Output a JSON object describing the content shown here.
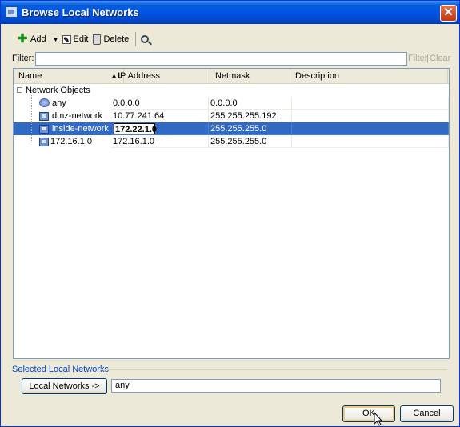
{
  "window": {
    "title": "Browse Local Networks",
    "close_symbol": "✕"
  },
  "toolbar": {
    "add_label": "Add",
    "edit_label": "Edit",
    "delete_label": "Delete",
    "dropdown_arrow": "▼"
  },
  "filter": {
    "label": "Filter:",
    "value": "",
    "filter_button": "Filter",
    "separator": "|",
    "clear_button": "Clear"
  },
  "table": {
    "columns": [
      "Name",
      "IP Address",
      "Netmask",
      "Description"
    ],
    "sort_indicator": "▲1",
    "group_label": "Network Objects",
    "tree_toggle": "−",
    "rows": [
      {
        "name": "any",
        "ip": "0.0.0.0",
        "netmask": "0.0.0.0",
        "description": "",
        "icon": "network-globe-icon"
      },
      {
        "name": "dmz-network",
        "ip": "10.77.241.64",
        "netmask": "255.255.255.192",
        "description": "",
        "icon": "network-object-icon"
      },
      {
        "name": "inside-network",
        "ip": "172.22.1.0",
        "netmask": "255.255.255.0",
        "description": "",
        "icon": "network-object-icon",
        "selected": true
      },
      {
        "name": "172.16.1.0",
        "ip": "172.16.1.0",
        "netmask": "255.255.255.0",
        "description": "",
        "icon": "network-object-icon"
      }
    ]
  },
  "selected": {
    "section_label": "Selected Local Networks",
    "button_label": "Local Networks ->",
    "value": "any"
  },
  "buttons": {
    "ok": "OK",
    "cancel": "Cancel"
  },
  "colors": {
    "title_bar": "#0054e3",
    "selection": "#316ac5",
    "section_label": "#0046d5",
    "window_bg": "#ece9d8"
  }
}
